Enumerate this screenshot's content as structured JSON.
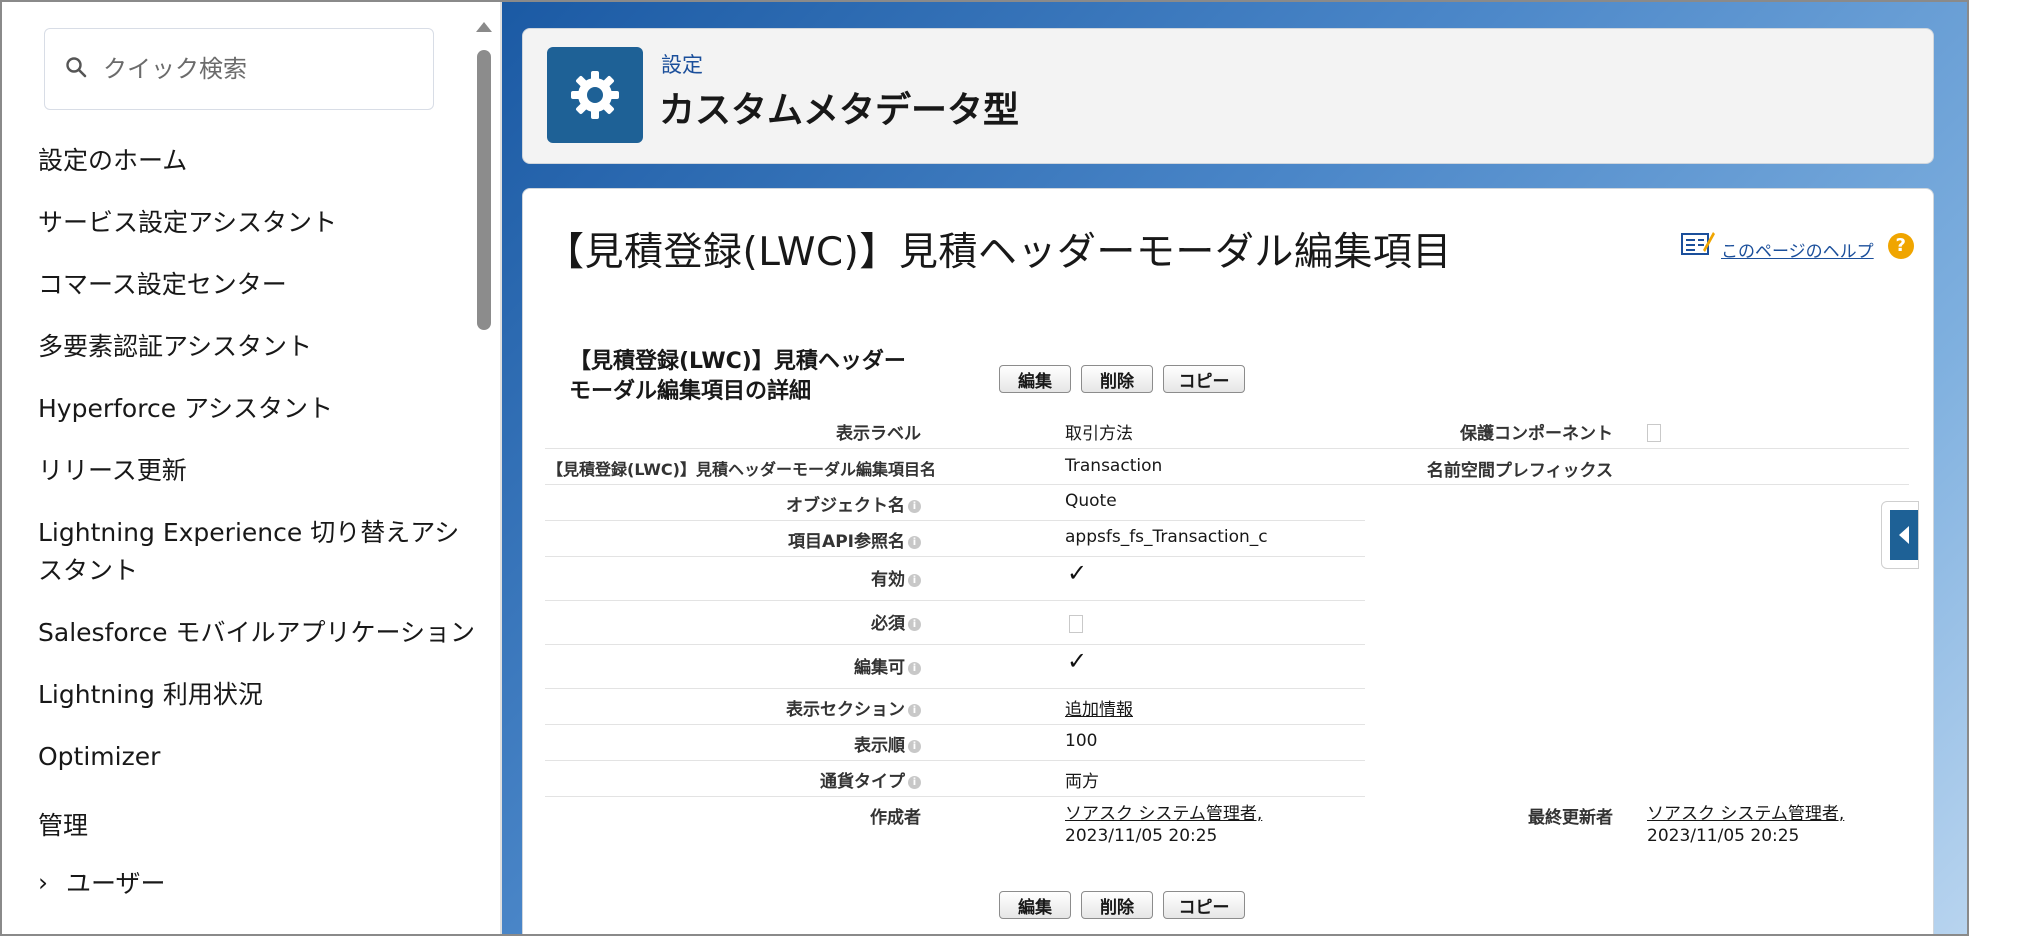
{
  "sidebar": {
    "search_placeholder": "クイック検索",
    "items": [
      {
        "label": "設定のホーム"
      },
      {
        "label": "サービス設定アシスタント"
      },
      {
        "label": "コマース設定センター"
      },
      {
        "label": "多要素認証アシスタント"
      },
      {
        "label": "Hyperforce アシスタント"
      },
      {
        "label": "リリース更新"
      },
      {
        "label": "Lightning Experience 切り替えアシスタント"
      },
      {
        "label": "Salesforce モバイルアプリケーション"
      },
      {
        "label": "Lightning 利用状況"
      },
      {
        "label": "Optimizer"
      }
    ],
    "section_label": "管理",
    "sub_item_label": "ユーザー",
    "sub_item_chevron": "›"
  },
  "header": {
    "breadcrumb": "設定",
    "title": "カスタムメタデータ型"
  },
  "record": {
    "title": "【見積登録(LWC)】見積ヘッダーモーダル編集項目",
    "help_label": "このページのヘルプ",
    "help_icon": "?",
    "detail_heading_line1": "【見積登録(LWC)】見積ヘッダー",
    "detail_heading_line2": "モーダル編集項目の詳細",
    "buttons": {
      "edit": "編集",
      "delete": "削除",
      "copy": "コピー"
    },
    "fields": {
      "display_label": {
        "label": "表示ラベル",
        "value": "取引方法"
      },
      "protected_component": {
        "label": "保護コンポーネント"
      },
      "record_name": {
        "label": "【見積登録(LWC)】見積ヘッダーモーダル編集項目名",
        "value": "Transaction"
      },
      "namespace_prefix": {
        "label": "名前空間プレフィックス"
      },
      "object_name": {
        "label": "オブジェクト名",
        "value": "Quote"
      },
      "field_api_ref": {
        "label": "項目API参照名",
        "value": "appsfs_fs_Transaction_c"
      },
      "enabled": {
        "label": "有効",
        "value": "✓"
      },
      "required": {
        "label": "必須"
      },
      "editable": {
        "label": "編集可",
        "value": "✓"
      },
      "display_section": {
        "label": "表示セクション",
        "value": "追加情報"
      },
      "display_order": {
        "label": "表示順",
        "value": "100"
      },
      "currency_type": {
        "label": "通貨タイプ",
        "value": "両方"
      },
      "created_by": {
        "label": "作成者",
        "value": "ソアスク システム管理者,",
        "date": "2023/11/05 20:25"
      },
      "last_modified_by": {
        "label": "最終更新者",
        "value": "ソアスク システム管理者,",
        "date": "2023/11/05 20:25"
      }
    }
  },
  "icons": {
    "search": "search-icon",
    "gear": "gear-icon",
    "help_book": "help-book-icon",
    "help_question": "question-icon",
    "info": "info-icon",
    "collapse": "chevron-left-icon"
  },
  "colors": {
    "brand_blue": "#1e6196",
    "link_blue": "#1b4f9b",
    "help_orange": "#f0a500"
  }
}
